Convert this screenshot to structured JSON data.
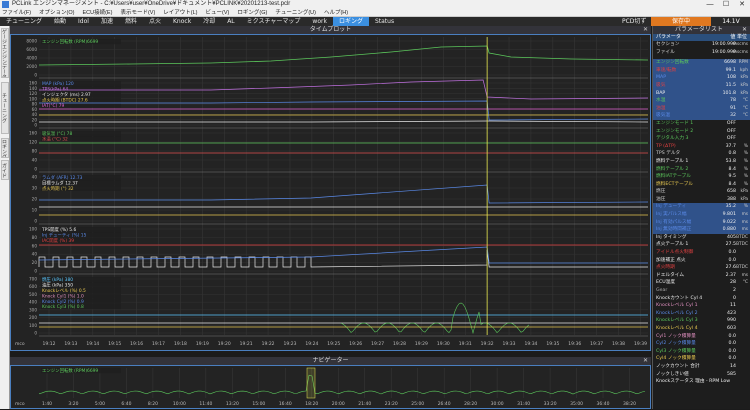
{
  "window": {
    "title": "PCLink エンジンマネージメント - C:¥Users¥user¥OneDrive¥ドキュメント¥PCLINK¥20201213-test.pclr",
    "minimize": "—",
    "maximize": "☐",
    "close": "✕"
  },
  "menu": [
    "ファイル(F)",
    "オプション(O)",
    "ECU接続(E)",
    "表示モード(V)",
    "レイアウト(L)",
    "ビュー(V)",
    "ロギング(G)",
    "チューニング(U)",
    "ヘルプ(H)"
  ],
  "tabs": [
    "チューニング",
    "始動",
    "Idol",
    "加速",
    "燃料",
    "点火",
    "Knock",
    "冷却",
    "AL",
    "ミクスチャーマップ",
    "work",
    "ロギング",
    "Status"
  ],
  "active_tab_index": 11,
  "status": {
    "pcd": "PCD切ず ~ Off",
    "record_button": "保存中",
    "voltage": "14.1V"
  },
  "side_tabs": [
    "ゲージエンジンデータ",
    "チューニング",
    "ロギングデータ",
    "ガイド"
  ],
  "timeplot": {
    "title": "タイムプロット",
    "close": "✕",
    "left_scale_label": "mco",
    "time_ticks": [
      "19:12",
      "19:13",
      "19:14",
      "19:15",
      "19:16",
      "19:17",
      "19:18",
      "19:19",
      "19:20",
      "19:21",
      "19:22",
      "19:23",
      "19:24",
      "19:25",
      "19:26",
      "19:27",
      "19:28",
      "19:29",
      "19:30",
      "19:31",
      "19:32",
      "19:33",
      "19:34",
      "19:35",
      "19:36",
      "19:37",
      "19:38",
      "19:39"
    ],
    "cursor_time_index": 20,
    "panes": [
      {
        "name": "rpm",
        "labels": [
          {
            "text": "エンジン回転数 (RPM)6699",
            "color": "#5cc85c"
          }
        ],
        "ticks": [
          "8000",
          "6000",
          "4000",
          "2000",
          "0"
        ]
      },
      {
        "name": "pressure",
        "labels": [
          {
            "text": "MAP (kPa)  120",
            "color": "#5a8ae8"
          },
          {
            "text": "TPS(kPa)  64",
            "color": "#c070e0"
          },
          {
            "text": "インジェクタ (ms)  2.97",
            "color": "#e8e8e8"
          },
          {
            "text": "点火時期 (BTDC)  27.6",
            "color": "#e8c850"
          },
          {
            "text": "IAT(°C)  79",
            "color": "#e060d0"
          }
        ],
        "ticks": [
          "160",
          "140",
          "120",
          "100",
          "80",
          "60",
          "40",
          "20",
          "0"
        ]
      },
      {
        "name": "lambda",
        "labels": [
          {
            "text": "吸気温 (°C)  78",
            "color": "#5cc85c"
          },
          {
            "text": "水温 (°C)  32",
            "color": "#e05050"
          }
        ],
        "ticks": [
          "160",
          "120",
          "80",
          "40",
          "0"
        ]
      },
      {
        "name": "timing",
        "labels": [
          {
            "text": "ラムダ (AFR)  12.73",
            "color": "#5a8ae8"
          },
          {
            "text": "目標ラムダ  12.37",
            "color": "#e8e8e8"
          },
          {
            "text": "点火時期 (°)  32",
            "color": "#e8c850"
          }
        ],
        "ticks": [
          "40",
          "30",
          "20",
          "10",
          "0"
        ]
      },
      {
        "name": "knock",
        "labels": [
          {
            "text": "TPS開度 (%)  5.6",
            "color": "#e8e8e8"
          },
          {
            "text": "Inj デューティ (%)  15",
            "color": "#5a8ae8"
          },
          {
            "text": "IAC開度 (%)  39",
            "color": "#e04040"
          }
        ],
        "ticks": [
          "100",
          "80",
          "60",
          "40",
          "20",
          "0"
        ]
      },
      {
        "name": "knocklevel",
        "labels": [
          {
            "text": "燃圧 (kPa)  380",
            "color": "#5cc8ff"
          },
          {
            "text": "油圧 (kPa)  350",
            "color": "#e8e8e8"
          },
          {
            "text": "Knockレベル (%)  0.5",
            "color": "#e8c850"
          },
          {
            "text": "Knock Cyl1 (%)  1.0",
            "color": "#e090c0"
          },
          {
            "text": "Knock Cyl2 (%)  0.9",
            "color": "#5a8ae8"
          },
          {
            "text": "Knock Cyl3 (%)  0.8",
            "color": "#5cc85c"
          }
        ],
        "ticks": [
          "700",
          "600",
          "500",
          "400",
          "300",
          "200",
          "100",
          "0"
        ]
      }
    ]
  },
  "navigator": {
    "title": "ナビゲーター",
    "close": "✕",
    "label": "エンジン回転数 (RPM)6699",
    "ticks": [
      "1:40",
      "3:20",
      "5:00",
      "6:40",
      "8:20",
      "10:00",
      "11:40",
      "13:20",
      "15:00",
      "16:40",
      "18:20",
      "20:00",
      "21:40",
      "23:20",
      "25:00",
      "26:40",
      "28:20",
      "30:00",
      "31:40",
      "33:20",
      "35:00",
      "36:40",
      "38:20"
    ],
    "left_scale_label": "mco"
  },
  "param_list": {
    "title": "パラメータリスト",
    "close": "✕",
    "header": {
      "name": "パラメータ",
      "value": "値",
      "unit": "単位"
    },
    "meta": [
      {
        "name": "セクション",
        "value": "19:00.999",
        "unit": "mscms"
      },
      {
        "name": "ファイル",
        "value": "19:00.999",
        "unit": "mscms"
      }
    ],
    "rows": [
      {
        "name": "エンジン回転数",
        "value": "6698",
        "unit": "RPM",
        "color": "#5cc85c",
        "highlight": true
      },
      {
        "name": "車速/転数",
        "value": "99.1",
        "unit": "kph",
        "color": "#e04040",
        "highlight": true
      },
      {
        "name": "MAP",
        "value": "108",
        "unit": "kPa",
        "color": "#5a8ae8",
        "highlight": true
      },
      {
        "name": "吸気",
        "value": "11.5",
        "unit": "kPa",
        "color": "#e04040",
        "highlight": true
      },
      {
        "name": "BAP",
        "value": "101.8",
        "unit": "kPa",
        "color": "#eee",
        "highlight": true
      },
      {
        "name": "水温",
        "value": "78",
        "unit": "°C",
        "color": "#5cc85c",
        "highlight": true
      },
      {
        "name": "油温",
        "value": "91",
        "unit": "°C",
        "color": "#e04040",
        "highlight": true
      },
      {
        "name": "吸気温",
        "value": "32",
        "unit": "°C",
        "color": "#5a8ae8",
        "highlight": true
      },
      {
        "name": "エンジンモード 1",
        "value": "OFF",
        "unit": "",
        "color": "#5cc85c",
        "highlight": false
      },
      {
        "name": "エンジンモード 2",
        "value": "OFF",
        "unit": "",
        "color": "#5cc85c",
        "highlight": false
      },
      {
        "name": "デジタル入力 3",
        "value": "OFF",
        "unit": "",
        "color": "#5cc85c",
        "highlight": false
      },
      {
        "name": "TP (ΔTP)",
        "value": "37.7",
        "unit": "%",
        "color": "#e04040",
        "highlight": false
      },
      {
        "name": "TPS デルタ",
        "value": "0.8",
        "unit": "%",
        "color": "#ccc",
        "highlight": false
      },
      {
        "name": "燃料テーブル 1",
        "value": "53.8",
        "unit": "%",
        "color": "#eee",
        "highlight": false
      },
      {
        "name": "燃料テーブル 2",
        "value": "8.4",
        "unit": "%",
        "color": "#5cc85c",
        "highlight": false
      },
      {
        "name": "燃料IATテーブル",
        "value": "9.5",
        "unit": "%",
        "color": "#5cc85c",
        "highlight": false
      },
      {
        "name": "燃料ECTテーブル",
        "value": "8.4",
        "unit": "%",
        "color": "#e8c850",
        "highlight": false
      },
      {
        "name": "燃圧",
        "value": "658",
        "unit": "kPa",
        "color": "#ccc",
        "highlight": false
      },
      {
        "name": "油圧",
        "value": "388",
        "unit": "kPa",
        "color": "#ccc",
        "highlight": false
      },
      {
        "name": "Inj デューティ",
        "value": "35.2",
        "unit": "%",
        "color": "#5a8ae8",
        "highlight": true
      },
      {
        "name": "Inj 実パルス幅",
        "value": "9.801",
        "unit": "ms",
        "color": "#5a8ae8",
        "highlight": true
      },
      {
        "name": "Inj 有効パルス幅",
        "value": "9.022",
        "unit": "ms",
        "color": "#5a8ae8",
        "highlight": true
      },
      {
        "name": "Inj 無効時間補正",
        "value": "0.880",
        "unit": "ms",
        "color": "#5a8ae8",
        "highlight": true
      },
      {
        "name": "Inj タイミング",
        "value": "405",
        "unit": "BTDC",
        "color": "#eee",
        "highlight": false
      },
      {
        "name": "点火テーブル 1",
        "value": "27.5",
        "unit": "BTDC",
        "color": "#eee",
        "highlight": false
      },
      {
        "name": "アイドル点火制御",
        "value": "0.0",
        "unit": "",
        "color": "#e04040",
        "highlight": false
      },
      {
        "name": "加速補正 点火",
        "value": "0.0",
        "unit": "",
        "color": "#eee",
        "highlight": false
      },
      {
        "name": "点火時期",
        "value": "27.6",
        "unit": "BTDC",
        "color": "#e04040",
        "highlight": false
      },
      {
        "name": "ドエルタイム",
        "value": "2.37",
        "unit": "ms",
        "color": "#eee",
        "highlight": false
      },
      {
        "name": "ECU温度",
        "value": "28",
        "unit": "°C",
        "color": "#eee",
        "highlight": false
      },
      {
        "name": "Gear",
        "value": "2",
        "unit": "",
        "color": "#aaa",
        "highlight": false
      },
      {
        "name": "Knockカウント Cyl 4",
        "value": "0",
        "unit": "",
        "color": "#eee",
        "highlight": false
      },
      {
        "name": "Knockレベル Cyl 1",
        "value": "11",
        "unit": "",
        "color": "#e090c0",
        "highlight": false
      },
      {
        "name": "Knockレベル Cyl 2",
        "value": "423",
        "unit": "",
        "color": "#5a8ae8",
        "highlight": false
      },
      {
        "name": "Knockレベル Cyl 3",
        "value": "990",
        "unit": "",
        "color": "#5cc85c",
        "highlight": false
      },
      {
        "name": "Knockレベル Cyl 4",
        "value": "603",
        "unit": "",
        "color": "#e8c850",
        "highlight": false
      },
      {
        "name": "Cyl1 ノック積算量",
        "value": "0.0",
        "unit": "",
        "color": "#e090c0",
        "highlight": false
      },
      {
        "name": "Cyl2 ノック積算量",
        "value": "0.0",
        "unit": "",
        "color": "#5a8ae8",
        "highlight": false
      },
      {
        "name": "Cyl3 ノック積算量",
        "value": "0.0",
        "unit": "",
        "color": "#5cc85c",
        "highlight": false
      },
      {
        "name": "Cyl4 ノック積算量",
        "value": "0.0",
        "unit": "",
        "color": "#e8c850",
        "highlight": false
      },
      {
        "name": "ノックカウント 合計",
        "value": "14",
        "unit": "",
        "color": "#eee",
        "highlight": false
      },
      {
        "name": "ノックしきい値",
        "value": "585",
        "unit": "",
        "color": "#eee",
        "highlight": false
      },
      {
        "name": "Knockステータス 理由 - RPM Low",
        "value": "",
        "unit": "",
        "color": "#eee",
        "highlight": false
      }
    ]
  }
}
